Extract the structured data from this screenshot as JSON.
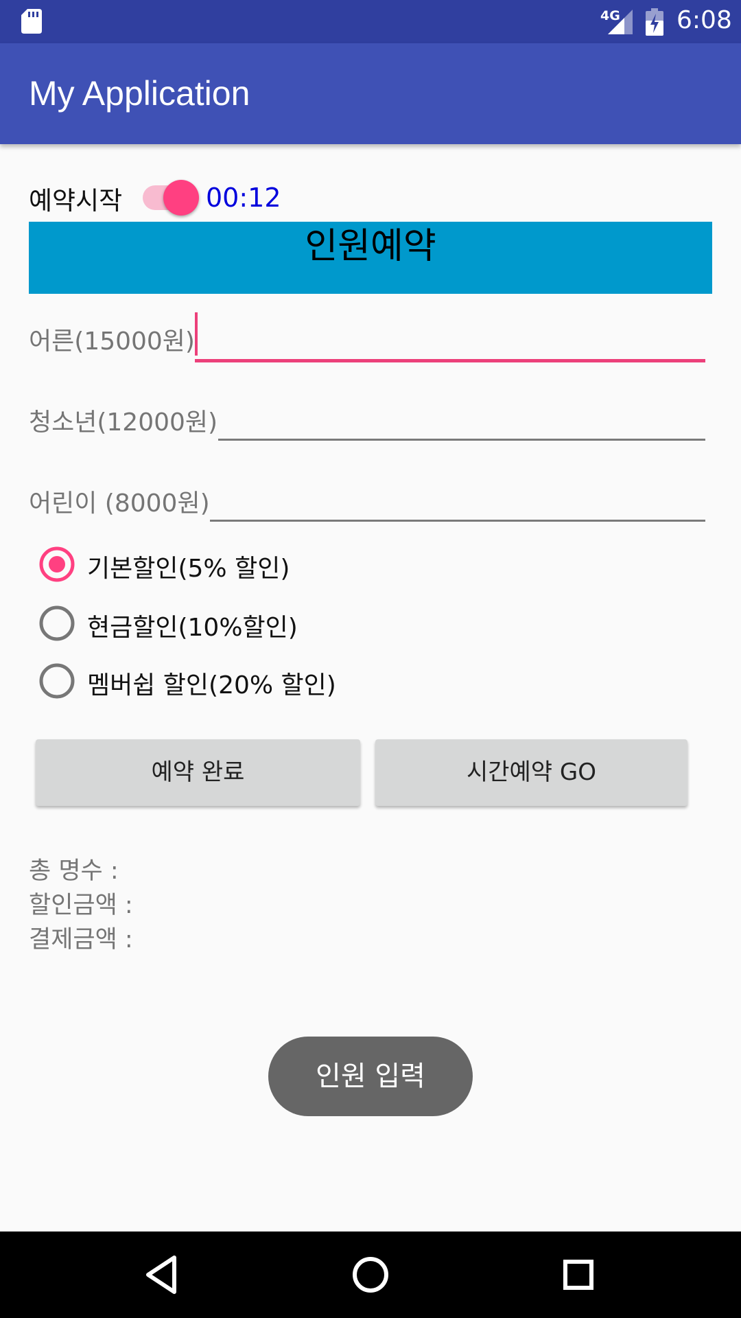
{
  "status_bar": {
    "network": "4G",
    "time": "6:08"
  },
  "app_bar": {
    "title": "My Application"
  },
  "reservation_switch": {
    "label": "예약시작",
    "checked": true,
    "timer": "00:12"
  },
  "banner": {
    "text": "인원예약"
  },
  "fields": [
    {
      "label": "어른(15000원)",
      "value": "",
      "focused": true
    },
    {
      "label": "청소년(12000원)",
      "value": ""
    },
    {
      "label": "어린이 (8000원)",
      "value": ""
    }
  ],
  "discounts": [
    {
      "label": "기본할인(5% 할인)",
      "selected": true
    },
    {
      "label": "현금할인(10%할인)",
      "selected": false
    },
    {
      "label": "멤버쉽 할인(20% 할인)",
      "selected": false
    }
  ],
  "buttons": {
    "complete": "예약 완료",
    "time_reserve": "시간예약 GO"
  },
  "summary": {
    "total_people": "총 명수 :",
    "discount_amount": "할인금액 :",
    "payment_amount": "결제금액 :"
  },
  "toast": {
    "text": "인원 입력"
  },
  "colors": {
    "status_bar": "#303f9f",
    "app_bar": "#3f51b5",
    "accent": "#ff4081",
    "banner": "#0099cc",
    "timer": "#0000dd"
  },
  "icons": {
    "status": [
      "sd-card-icon",
      "signal-icon",
      "battery-charging-icon"
    ],
    "nav": [
      "back-icon",
      "home-icon",
      "recents-icon"
    ]
  }
}
